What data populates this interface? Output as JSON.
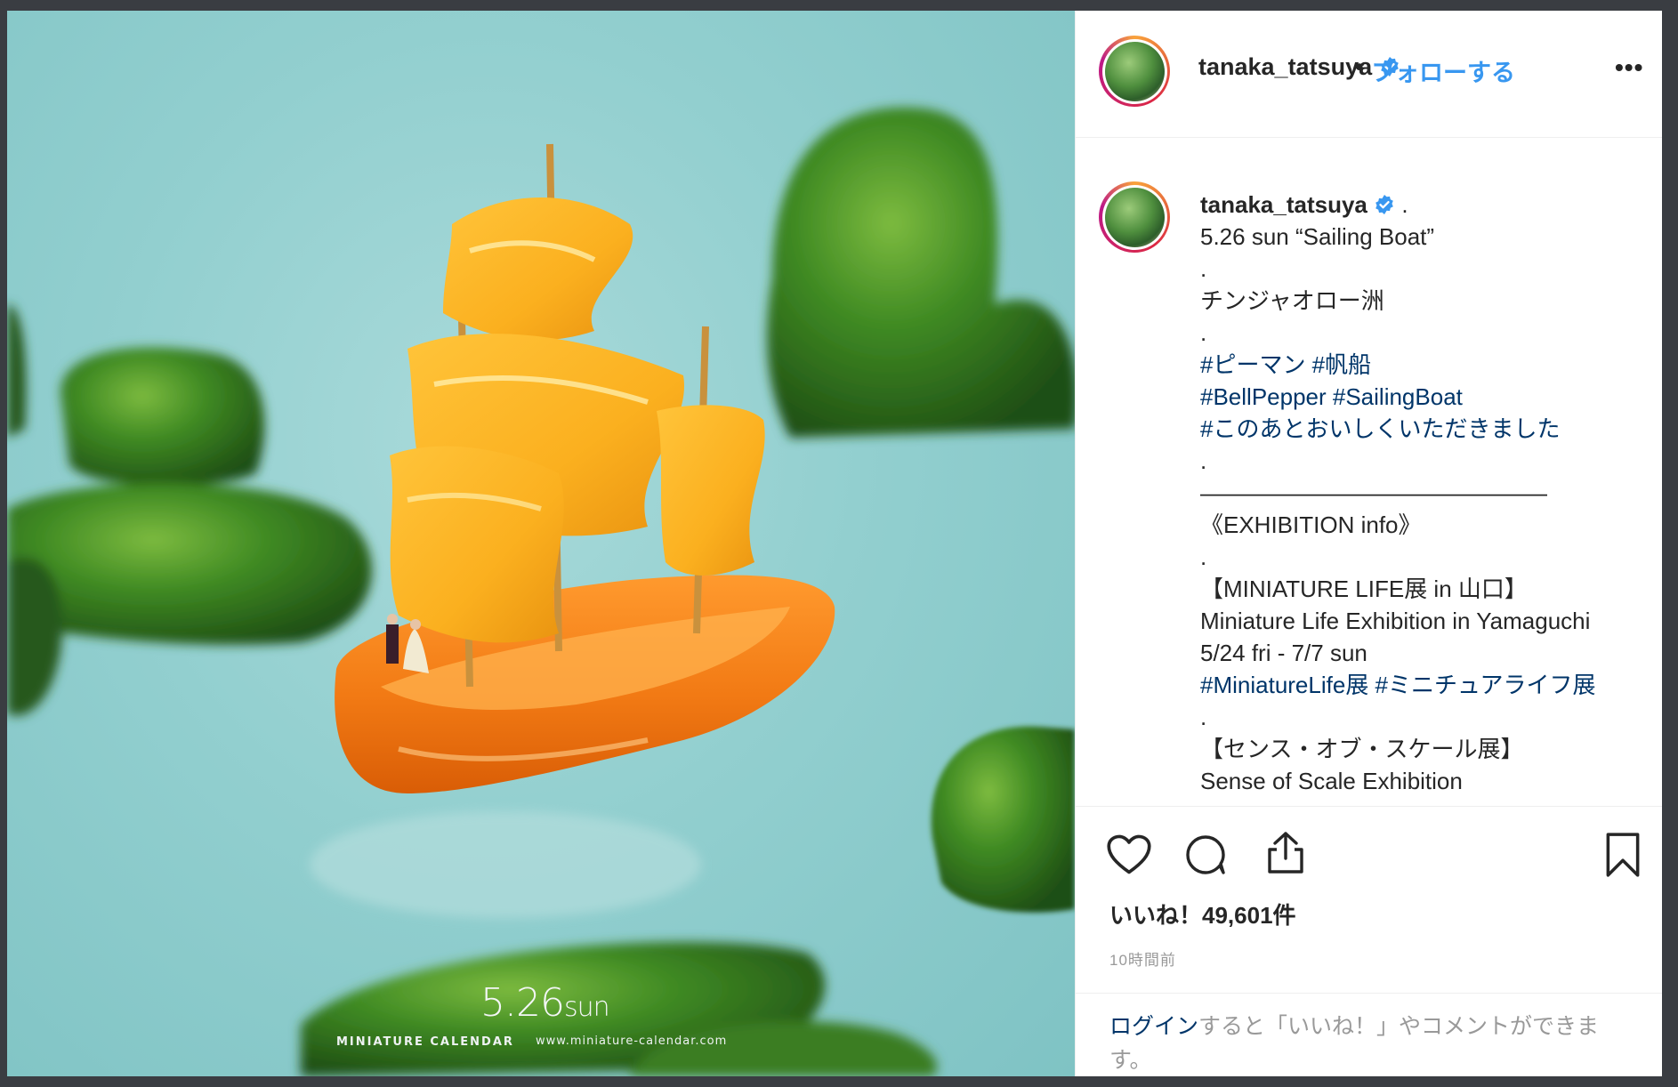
{
  "photo": {
    "date_main": "5.26",
    "date_day": "sun",
    "brand": "MINIATURE CALENDAR",
    "url": "www.miniature-calendar.com"
  },
  "header": {
    "username": "tanaka_tatsuya",
    "separator": "•",
    "follow_label": "フォローする",
    "more_label": "•••"
  },
  "caption": {
    "username": "tanaka_tatsuya",
    "after_name": ".",
    "lines": [
      {
        "text": "5.26 sun “Sailing Boat”",
        "type": "text"
      },
      {
        "text": ".",
        "type": "text"
      },
      {
        "text": "チンジャオロー洲",
        "type": "text"
      },
      {
        "text": ".",
        "type": "text"
      },
      {
        "text": "#ピーマン #帆船",
        "type": "tag"
      },
      {
        "text": "#BellPepper #SailingBoat",
        "type": "tag"
      },
      {
        "text": "#このあとおいしくいただきました",
        "type": "tag"
      },
      {
        "text": ".",
        "type": "text"
      },
      {
        "text": "———————————————",
        "type": "text"
      },
      {
        "text": "《EXHIBITION info》",
        "type": "text"
      },
      {
        "text": ".",
        "type": "text"
      },
      {
        "text": "【MINIATURE LIFE展 in 山口】",
        "type": "text"
      },
      {
        "text": "Miniature Life Exhibition in Yamaguchi",
        "type": "text"
      },
      {
        "text": "5/24 fri - 7/7 sun",
        "type": "text"
      },
      {
        "text": "#MiniatureLife展 #ミニチュアライフ展",
        "type": "tag"
      },
      {
        "text": ".",
        "type": "text"
      },
      {
        "text": "【センス・オブ・スケール展】",
        "type": "text"
      },
      {
        "text": "Sense of Scale Exhibition",
        "type": "text"
      }
    ]
  },
  "actions": {
    "likes": "いいね！49,601件",
    "time": "10時間前",
    "icons": [
      "heart-icon",
      "comment-icon",
      "share-icon",
      "bookmark-icon"
    ]
  },
  "login": {
    "link": "ログイン",
    "text": "すると「いいね！」やコメントができます。"
  },
  "colors": {
    "link": "#3897f0",
    "hashtag": "#003569",
    "verified": "#3897f0",
    "background": "#8fcccd"
  }
}
